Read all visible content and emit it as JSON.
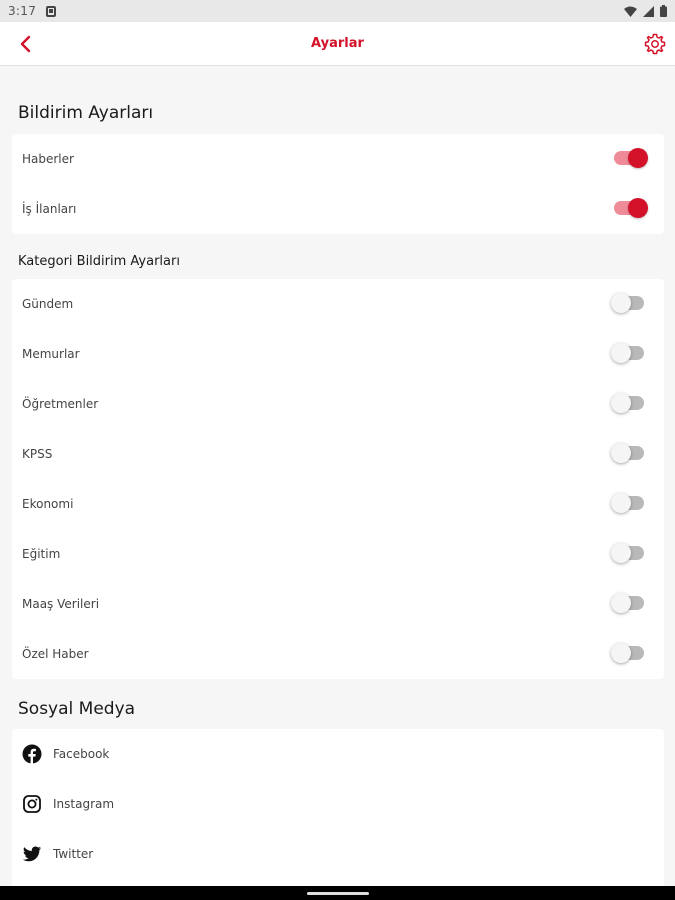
{
  "status_bar": {
    "time": "3:17"
  },
  "app_bar": {
    "title": "Ayarlar"
  },
  "notification_settings": {
    "heading": "Bildirim Ayarları",
    "items": [
      {
        "label": "Haberler",
        "enabled": true
      },
      {
        "label": "İş İlanları",
        "enabled": true
      }
    ]
  },
  "category_settings": {
    "heading": "Kategori Bildirim Ayarları",
    "items": [
      {
        "label": "Gündem",
        "enabled": false
      },
      {
        "label": "Memurlar",
        "enabled": false
      },
      {
        "label": "Öğretmenler",
        "enabled": false
      },
      {
        "label": "KPSS",
        "enabled": false
      },
      {
        "label": "Ekonomi",
        "enabled": false
      },
      {
        "label": "Eğitim",
        "enabled": false
      },
      {
        "label": "Maaş Verileri",
        "enabled": false
      },
      {
        "label": "Özel Haber",
        "enabled": false
      }
    ]
  },
  "social_media": {
    "heading": "Sosyal Medya",
    "items": [
      {
        "label": "Facebook",
        "icon": "facebook-icon"
      },
      {
        "label": "Instagram",
        "icon": "instagram-icon"
      },
      {
        "label": "Twitter",
        "icon": "twitter-icon"
      }
    ]
  },
  "colors": {
    "accent": "#d3122a",
    "toggle_on_track": "#ef8b98",
    "background": "#f6f6f6"
  }
}
